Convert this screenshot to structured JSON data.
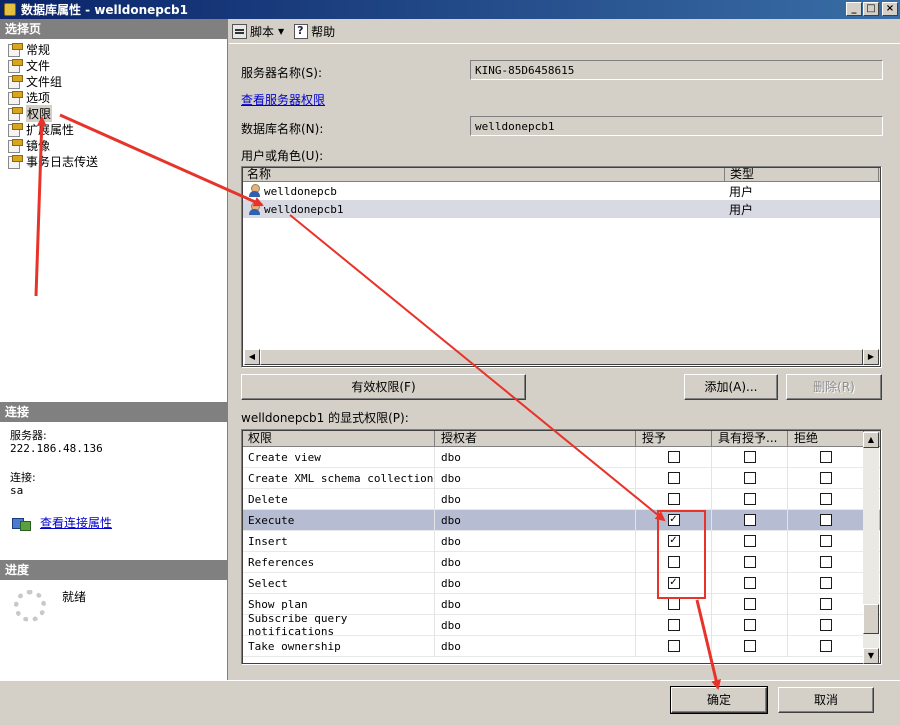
{
  "window": {
    "title": "数据库属性 - welldonepcb1"
  },
  "left": {
    "pages_header": "选择页",
    "pages": [
      "常规",
      "文件",
      "文件组",
      "选项",
      "权限",
      "扩展属性",
      "镜像",
      "事务日志传送"
    ],
    "selected_index": 4,
    "connection_header": "连接",
    "server_label": "服务器:",
    "server_value": "222.186.48.136",
    "conn_label": "连接:",
    "conn_value": "sa",
    "view_conn_link": "查看连接属性",
    "progress_header": "进度",
    "progress_status": "就绪"
  },
  "toolbar": {
    "script_label": "脚本",
    "help_label": "帮助"
  },
  "form": {
    "server_name_label": "服务器名称(S):",
    "server_name_value": "KING-85D6458615",
    "view_server_perm_link": "查看服务器权限",
    "db_name_label": "数据库名称(N):",
    "db_name_value": "welldonepcb1",
    "users_label": "用户或角色(U):"
  },
  "users_list": {
    "col_name": "名称",
    "col_type": "类型",
    "rows": [
      {
        "name": "welldonepcb",
        "type": "用户"
      },
      {
        "name": "welldonepcb1",
        "type": "用户"
      }
    ],
    "selected_index": 1
  },
  "buttons": {
    "effective_perm": "有效权限(F)",
    "add": "添加(A)...",
    "remove": "删除(R)",
    "ok": "确定",
    "cancel": "取消"
  },
  "perm_grid": {
    "caption": "welldonepcb1 的显式权限(P):",
    "columns": [
      "权限",
      "授权者",
      "授予",
      "具有授予...",
      "拒绝"
    ],
    "rows": [
      {
        "perm": "Create view",
        "grantor": "dbo",
        "grant": false,
        "with_grant": false,
        "deny": false
      },
      {
        "perm": "Create XML schema collection",
        "grantor": "dbo",
        "grant": false,
        "with_grant": false,
        "deny": false
      },
      {
        "perm": "Delete",
        "grantor": "dbo",
        "grant": false,
        "with_grant": false,
        "deny": false
      },
      {
        "perm": "Execute",
        "grantor": "dbo",
        "grant": true,
        "with_grant": false,
        "deny": false
      },
      {
        "perm": "Insert",
        "grantor": "dbo",
        "grant": true,
        "with_grant": false,
        "deny": false
      },
      {
        "perm": "References",
        "grantor": "dbo",
        "grant": false,
        "with_grant": false,
        "deny": false
      },
      {
        "perm": "Select",
        "grantor": "dbo",
        "grant": true,
        "with_grant": false,
        "deny": false
      },
      {
        "perm": "Show plan",
        "grantor": "dbo",
        "grant": false,
        "with_grant": false,
        "deny": false
      },
      {
        "perm": "Subscribe query notifications",
        "grantor": "dbo",
        "grant": false,
        "with_grant": false,
        "deny": false
      },
      {
        "perm": "Take ownership",
        "grantor": "dbo",
        "grant": false,
        "with_grant": false,
        "deny": false
      }
    ],
    "selected_index": 3
  },
  "colors": {
    "annotation": "#e8332a",
    "titlebar": "#0a246a"
  }
}
